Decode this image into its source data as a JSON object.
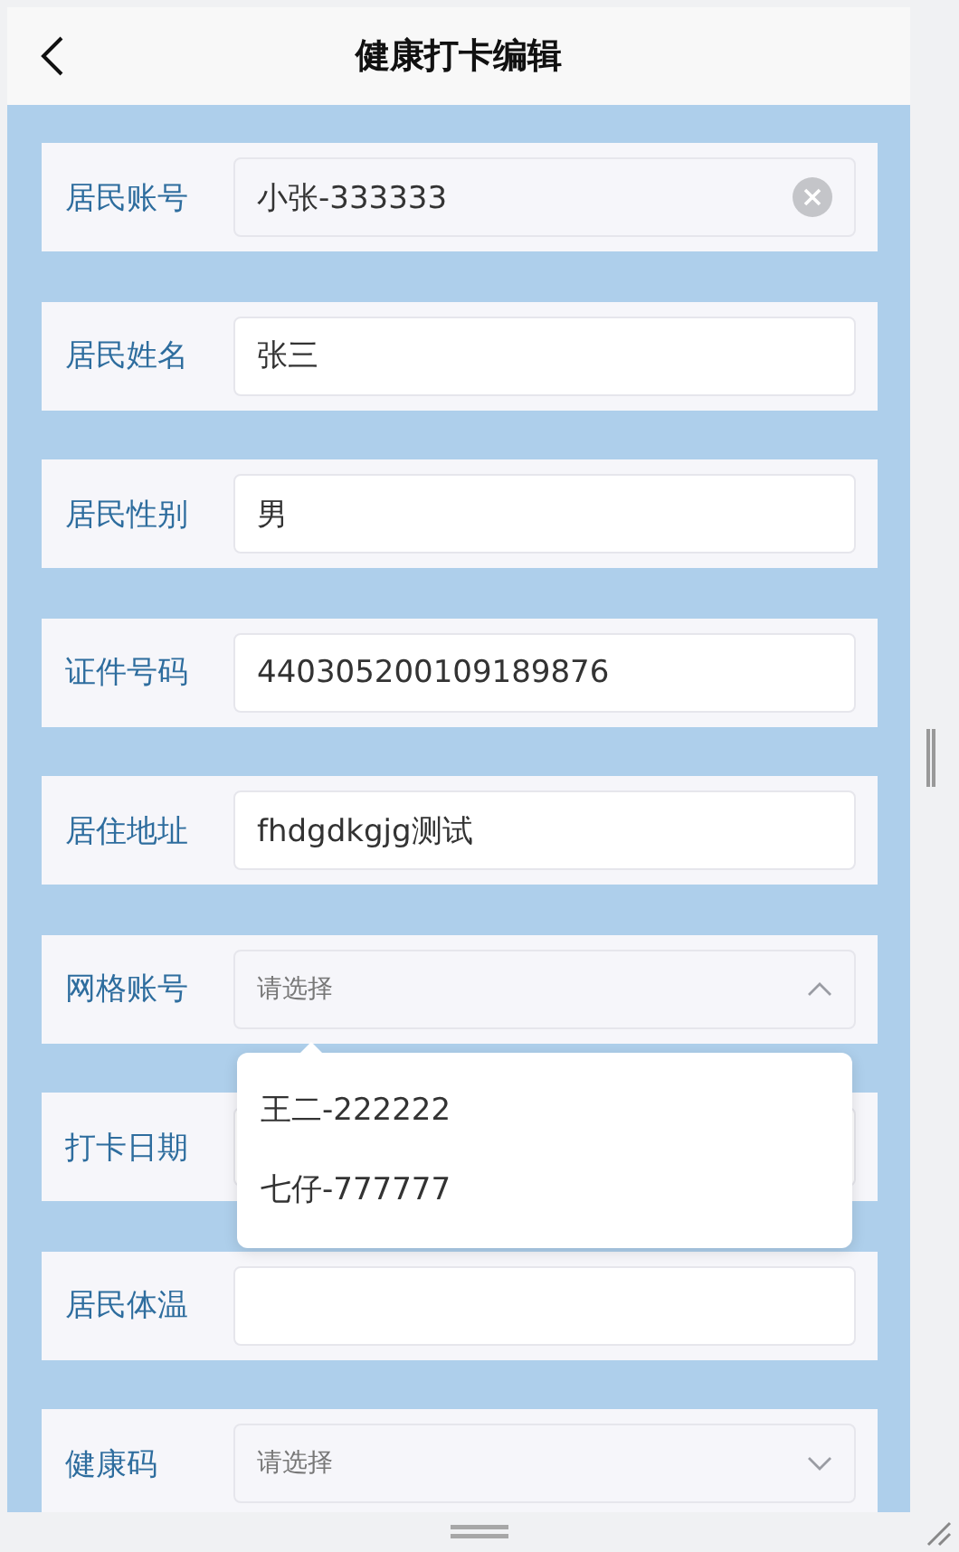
{
  "header": {
    "title": "健康打卡编辑"
  },
  "fields": [
    {
      "label": "居民账号",
      "kind": "readonly",
      "value": "小张-333333",
      "clearable": true
    },
    {
      "label": "居民姓名",
      "kind": "text",
      "value": "张三"
    },
    {
      "label": "居民性别",
      "kind": "text",
      "value": "男"
    },
    {
      "label": "证件号码",
      "kind": "text",
      "value": "440305200109189876"
    },
    {
      "label": "居住地址",
      "kind": "text",
      "value": "fhdgdkgjg测试"
    },
    {
      "label": "网格账号",
      "kind": "select",
      "placeholder": "请选择",
      "expanded": true,
      "options": [
        {
          "label": "王二-222222"
        },
        {
          "label": "七仔-777777"
        }
      ]
    },
    {
      "label": "打卡日期",
      "kind": "text"
    },
    {
      "label": "居民体温",
      "kind": "text"
    },
    {
      "label": "健康码",
      "kind": "select",
      "placeholder": "请选择",
      "expanded": false
    }
  ]
}
